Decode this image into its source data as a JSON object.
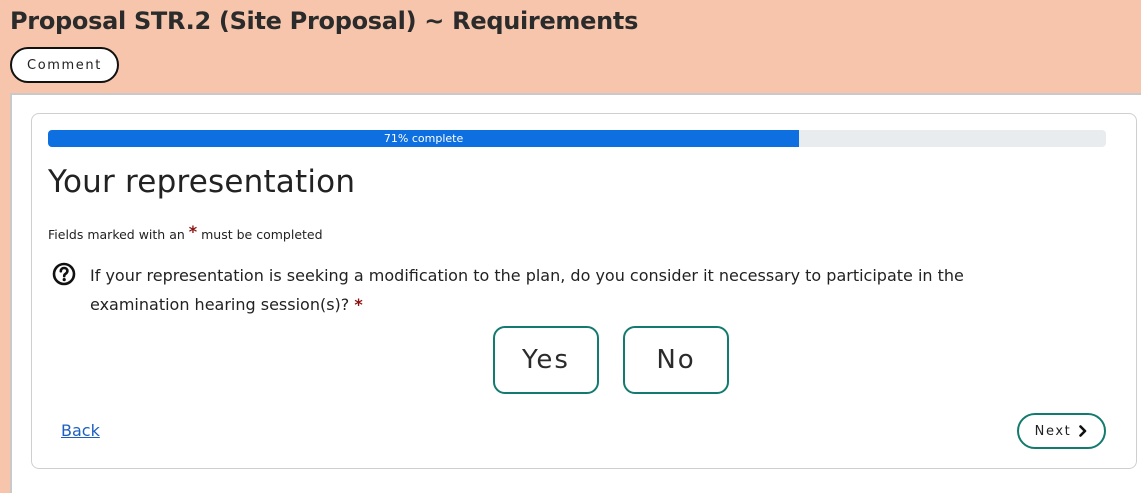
{
  "page": {
    "title": "Proposal STR.2 (Site Proposal) ~ Requirements"
  },
  "toolbar": {
    "comment_label": "Comment"
  },
  "form": {
    "progress": {
      "percent": 71,
      "label": "71% complete"
    },
    "section_title": "Your representation",
    "required_note": {
      "before": "Fields marked with an",
      "asterisk": "*",
      "after": "must be completed"
    },
    "question": {
      "text": "If your representation is seeking a modification to the plan, do you consider it necessary to participate in the examination hearing session(s)?",
      "required_marker": "*"
    },
    "options": [
      {
        "label": "Yes"
      },
      {
        "label": "No"
      }
    ],
    "nav": {
      "back_label": "Back",
      "next_label": "Next"
    }
  },
  "colors": {
    "page_background": "#f6c5ac",
    "progress_fill": "#0d6fe0",
    "progress_track": "#e9ecef",
    "accent_border": "#127a6f",
    "required_asterisk": "#8b1010",
    "link": "#1c5fc0"
  },
  "icons": {
    "help": "question-circle-icon",
    "next": "chevron-right-icon"
  }
}
